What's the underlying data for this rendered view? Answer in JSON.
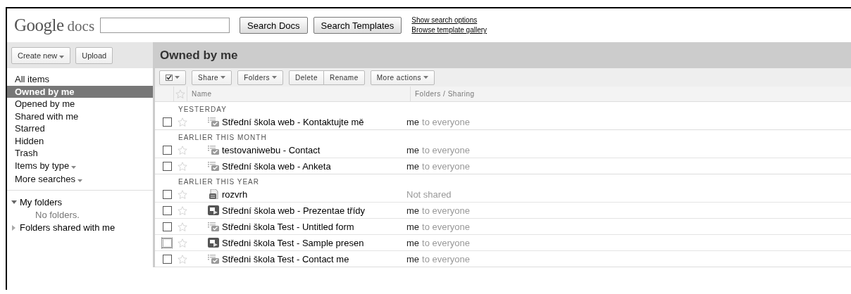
{
  "header": {
    "logo": {
      "brand": "Google",
      "product": "docs"
    },
    "buttons": [
      "Search Docs",
      "Search Templates"
    ],
    "links": [
      "Show search options",
      "Browse template gallery"
    ]
  },
  "sidebar": {
    "buttons": [
      {
        "label": "Create new",
        "dropdown": true
      },
      {
        "label": "Upload",
        "dropdown": false
      }
    ],
    "items": [
      {
        "label": "All items",
        "selected": false,
        "dropdown": false
      },
      {
        "label": "Owned by me",
        "selected": true,
        "dropdown": false
      },
      {
        "label": "Opened by me",
        "selected": false,
        "dropdown": false
      },
      {
        "label": "Shared with me",
        "selected": false,
        "dropdown": false
      },
      {
        "label": "Starred",
        "selected": false,
        "dropdown": false
      },
      {
        "label": "Hidden",
        "selected": false,
        "dropdown": false
      },
      {
        "label": "Trash",
        "selected": false,
        "dropdown": false
      },
      {
        "label": "Items by type",
        "selected": false,
        "dropdown": true
      },
      {
        "label": "More searches",
        "selected": false,
        "dropdown": true
      }
    ],
    "folders": [
      {
        "label": "My folders",
        "expanded": true,
        "empty_text": "No folders."
      },
      {
        "label": "Folders shared with me",
        "expanded": false
      }
    ]
  },
  "main": {
    "title": "Owned by me",
    "toolbar": [
      {
        "kind": "select"
      },
      {
        "label": "Share",
        "kind": "menu"
      },
      {
        "label": "Folders",
        "kind": "menu"
      },
      {
        "label": "Delete",
        "kind": "left"
      },
      {
        "label": "Rename",
        "kind": "right"
      },
      {
        "label": "More actions",
        "kind": "menu"
      }
    ],
    "columns": [
      "Name",
      "Folders / Sharing"
    ],
    "groups": [
      {
        "label": "YESTERDAY",
        "rows": [
          {
            "name": "Střední škola web - Kontaktujte mě",
            "kind": "form",
            "owner": "me",
            "sharing": "to everyone",
            "checked": false,
            "starred": false,
            "focused": false
          }
        ]
      },
      {
        "label": "EARLIER THIS MONTH",
        "rows": [
          {
            "name": "testovaniwebu - Contact",
            "kind": "form",
            "owner": "me",
            "sharing": "to everyone",
            "checked": false,
            "starred": false,
            "focused": false
          },
          {
            "name": "Střední škola web - Anketa",
            "kind": "form",
            "owner": "me",
            "sharing": "to everyone",
            "checked": false,
            "starred": false,
            "focused": false
          }
        ]
      },
      {
        "label": "EARLIER THIS YEAR",
        "rows": [
          {
            "name": "rozvrh",
            "kind": "spreadsheet",
            "sharing": "Not shared",
            "checked": false,
            "starred": false,
            "focused": false
          },
          {
            "name": "Střední škola web - Prezentae třídy",
            "kind": "presentation",
            "owner": "me",
            "sharing": "to everyone",
            "checked": false,
            "starred": false,
            "focused": false
          },
          {
            "name": "Středni škola Test - Untitled form",
            "kind": "form",
            "owner": "me",
            "sharing": "to everyone",
            "checked": false,
            "starred": false,
            "focused": false
          },
          {
            "name": "Středni škola Test - Sample presen",
            "kind": "presentation",
            "owner": "me",
            "sharing": "to everyone",
            "checked": false,
            "starred": false,
            "focused": true
          },
          {
            "name": "Středni škola Test - Contact me",
            "kind": "form",
            "owner": "me",
            "sharing": "to everyone",
            "checked": false,
            "starred": false,
            "focused": false
          }
        ]
      }
    ]
  }
}
